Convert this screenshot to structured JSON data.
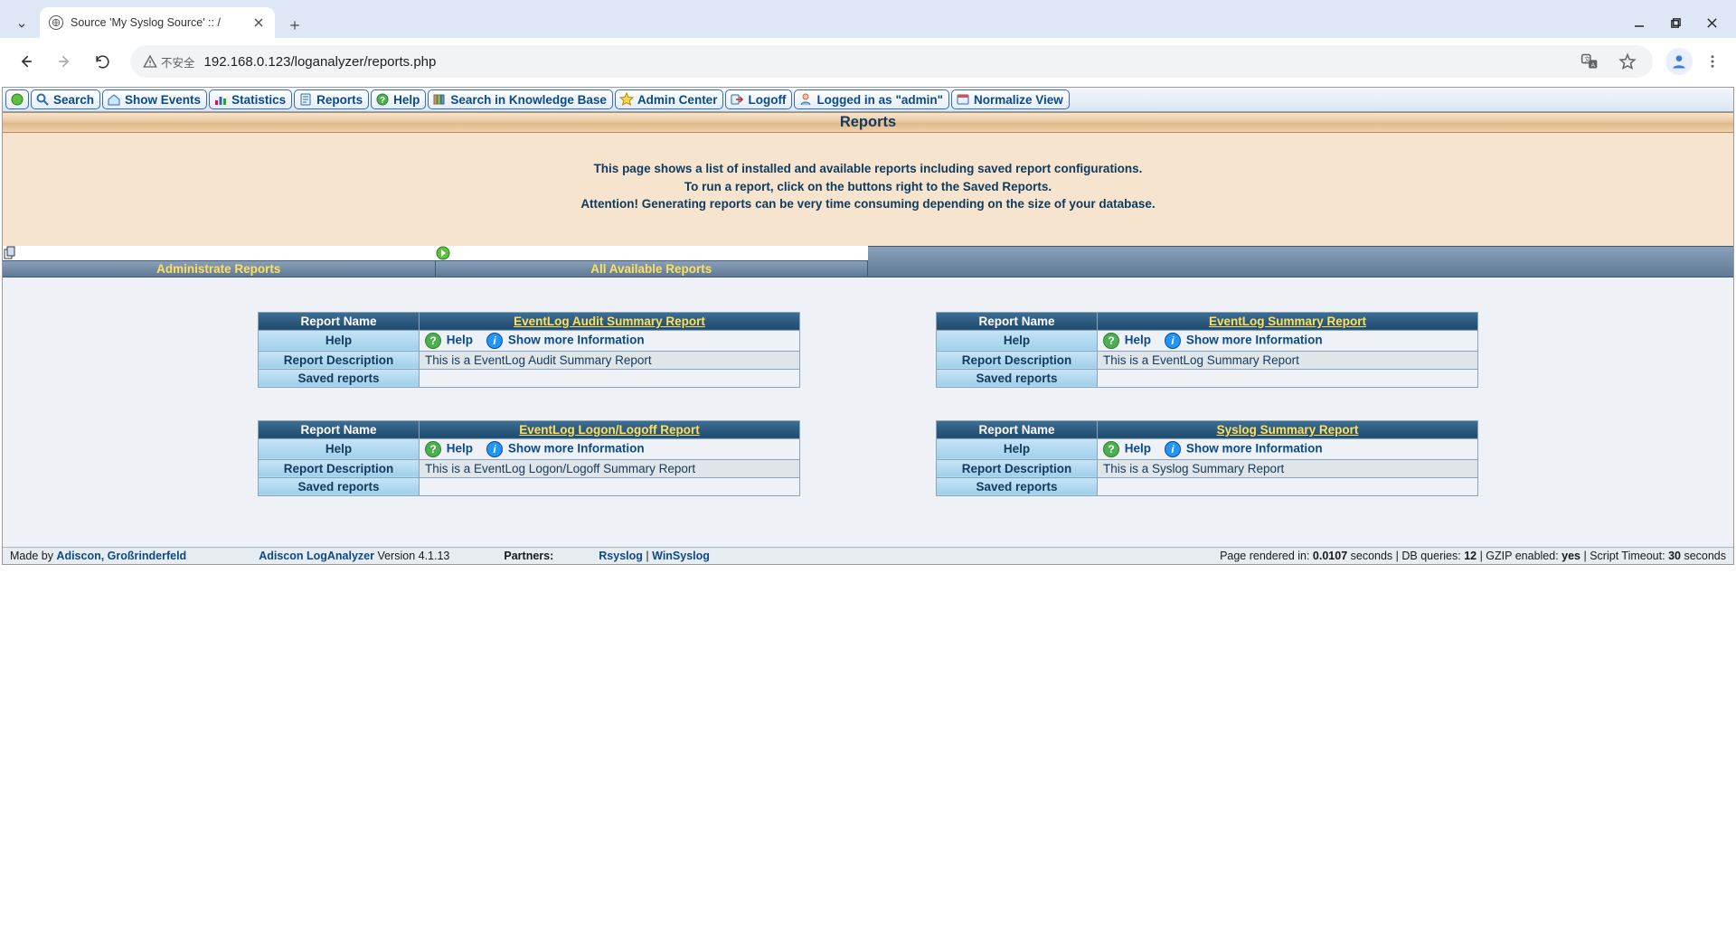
{
  "browser": {
    "tab_title": "Source 'My Syslog Source' :: /",
    "url": "192.168.0.123/loganalyzer/reports.php",
    "insecure_label": "不安全"
  },
  "menubar": {
    "search": "Search",
    "show_events": "Show Events",
    "statistics": "Statistics",
    "reports": "Reports",
    "help": "Help",
    "kb": "Search in Knowledge Base",
    "admin": "Admin Center",
    "logoff": "Logoff",
    "logged_in": "Logged in as \"admin\"",
    "normalize": "Normalize View"
  },
  "page": {
    "title": "Reports",
    "intro1": "This page shows a list of installed and available reports including saved report configurations.",
    "intro2": "To run a report, click on the buttons right to the Saved Reports.",
    "intro3": "Attention! Generating reports can be very time consuming depending on the size of your database."
  },
  "subtabs": {
    "admin_reports": "Administrate Reports",
    "all_reports": "All Available Reports"
  },
  "labels": {
    "report_name": "Report Name",
    "help": "Help",
    "description": "Report Description",
    "saved": "Saved reports",
    "help_link": "Help",
    "more_info": "Show more Information"
  },
  "reports": [
    {
      "title": "EventLog Audit Summary Report",
      "desc": "This is a EventLog Audit Summary Report"
    },
    {
      "title": "EventLog Summary Report",
      "desc": "This is a EventLog Summary Report"
    },
    {
      "title": "EventLog Logon/Logoff Report",
      "desc": "This is a EventLog Logon/Logoff Summary Report"
    },
    {
      "title": "Syslog Summary Report",
      "desc": "This is a Syslog Summary Report"
    }
  ],
  "footer": {
    "made_by_prefix": "Made by ",
    "made_by_link": "Adiscon, Großrinderfeld",
    "product": "Adiscon LogAnalyzer",
    "version": " Version 4.1.13",
    "partners": "Partners:",
    "partner1": "Rsyslog",
    "partner_sep": " | ",
    "partner2": "WinSyslog",
    "rendered_prefix": "Page rendered in: ",
    "rendered_val": "0.0107",
    "rendered_suffix": " seconds",
    "db_prefix": "  |  DB queries: ",
    "db_val": "12",
    "gzip_prefix": "  |  GZIP enabled: ",
    "gzip_val": "yes",
    "timeout_prefix": "  |  Script Timeout: ",
    "timeout_val": "30",
    "timeout_suffix": " seconds"
  }
}
